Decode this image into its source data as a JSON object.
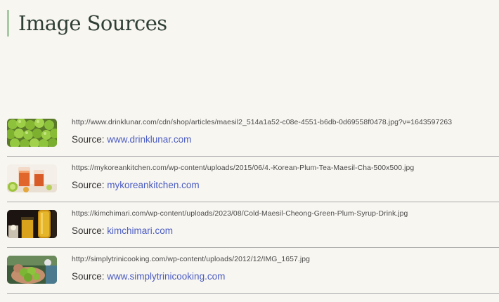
{
  "page": {
    "title": "Image Sources"
  },
  "sources": [
    {
      "thumbnail_icon": "green-plums-image",
      "url": "http://www.drinklunar.com/cdn/shop/articles/maesil2_514a1a52-c08e-4551-b6db-0d69558f0478.jpg?v=1643597263",
      "source_label": "Source: ",
      "source_link": "www.drinklunar.com"
    },
    {
      "thumbnail_icon": "plum-tea-glasses-image",
      "url": "https://mykoreankitchen.com/wp-content/uploads/2015/06/4.-Korean-Plum-Tea-Maesil-Cha-500x500.jpg",
      "source_label": "Source: ",
      "source_link": "mykoreankitchen.com"
    },
    {
      "thumbnail_icon": "plum-syrup-bottle-image",
      "url": "https://kimchimari.com/wp-content/uploads/2023/08/Cold-Maesil-Cheong-Green-Plum-Syrup-Drink.jpg",
      "source_label": "Source: ",
      "source_link": "kimchimari.com"
    },
    {
      "thumbnail_icon": "hand-holding-limes-image",
      "url": "http://simplytrinicooking.com/wp-content/uploads/2012/12/IMG_1657.jpg",
      "source_label": "Source: ",
      "source_link": "www.simplytrinicooking.com"
    }
  ],
  "colors": {
    "background": "#f8f6f1",
    "heading_accent": "#a8c9a6",
    "heading_text": "#2f3f36",
    "link": "#4a5cc2",
    "divider": "#a9a9a9"
  }
}
